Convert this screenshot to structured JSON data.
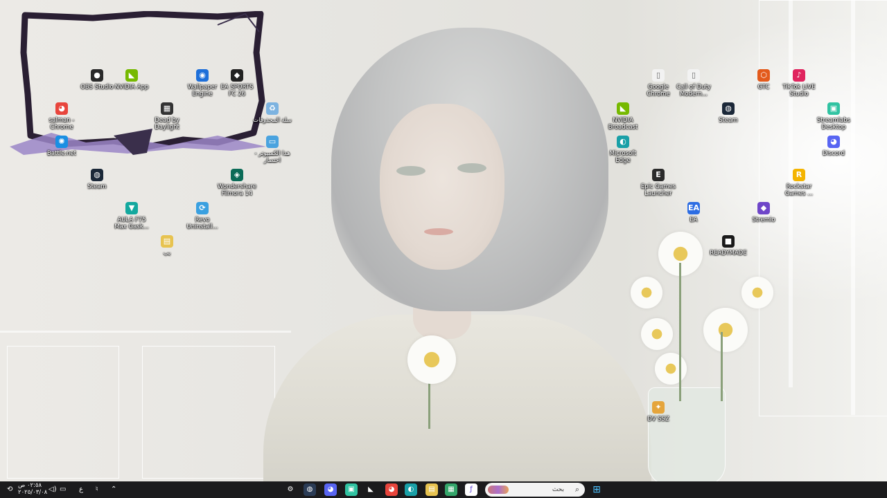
{
  "desktop": {
    "icons": [
      {
        "key": "obs",
        "label": "OBS Studio",
        "color": "#2a2a2a",
        "glyph": "●",
        "icon": "obs-icon"
      },
      {
        "key": "nvapp",
        "label": "NVIDIA App",
        "color": "#76b900",
        "glyph": "◣",
        "icon": "nvidia-icon"
      },
      {
        "key": "wallpaper",
        "label": "Wallpaper Engine",
        "color": "#1e6fd9",
        "glyph": "◉",
        "icon": "wallpaper-engine-icon"
      },
      {
        "key": "eafc",
        "label": "EA SPORTS FC 26",
        "color": "#222222",
        "glyph": "◆",
        "icon": "ea-fc-icon"
      },
      {
        "key": "chrome_user",
        "label": "salman - Chrome",
        "color": "#e8453c",
        "glyph": "◕",
        "icon": "chrome-icon"
      },
      {
        "key": "dbd",
        "label": "Dead by Daylight",
        "color": "#333333",
        "glyph": "▦",
        "icon": "dead-by-daylight-icon"
      },
      {
        "key": "recycle",
        "label": "سلة المحذوفات",
        "color": "#7db3e0",
        "glyph": "♻",
        "icon": "recycle-bin-icon"
      },
      {
        "key": "battlenet",
        "label": "Battle.net",
        "color": "#1a8fe3",
        "glyph": "✺",
        "icon": "battlenet-icon"
      },
      {
        "key": "pc",
        "label": "هذا الكمبيوتر - اختصار",
        "color": "#4aa3df",
        "glyph": "▭",
        "icon": "this-pc-icon"
      },
      {
        "key": "steam1",
        "label": "Steam",
        "color": "#1b2838",
        "glyph": "◍",
        "icon": "steam-icon"
      },
      {
        "key": "filmora",
        "label": "Wondershare Filmora 14",
        "color": "#0b6b57",
        "glyph": "◈",
        "icon": "filmora-icon"
      },
      {
        "key": "aura",
        "label": "AULA F75 Max Gask...",
        "color": "#13a89e",
        "glyph": "▼",
        "icon": "aula-keyboard-icon"
      },
      {
        "key": "revo",
        "label": "Revo Uninstall...",
        "color": "#3aa0e0",
        "glyph": "⟳",
        "icon": "revo-uninstaller-icon"
      },
      {
        "key": "folder",
        "label": "بب",
        "color": "#e7c350",
        "glyph": "▤",
        "icon": "folder-icon"
      },
      {
        "key": "gchrome",
        "label": "Google Chrome",
        "color": "#f2f2f2",
        "glyph": "▯",
        "icon": "file-shortcut-icon"
      },
      {
        "key": "cod",
        "label": "Call of Duty Modern...",
        "color": "#f2f2f2",
        "glyph": "▯",
        "icon": "file-shortcut-icon"
      },
      {
        "key": "gtc",
        "label": "GTC",
        "color": "#e35a1b",
        "glyph": "⬡",
        "icon": "gtc-icon"
      },
      {
        "key": "tiktok",
        "label": "TikTok LIVE Studio",
        "color": "#e0245e",
        "glyph": "♪",
        "icon": "tiktok-live-icon"
      },
      {
        "key": "nvbroadcast",
        "label": "NVIDIA Broadcast",
        "color": "#76b900",
        "glyph": "◣",
        "icon": "nvidia-broadcast-icon"
      },
      {
        "key": "steam2",
        "label": "Steam",
        "color": "#1b2838",
        "glyph": "◍",
        "icon": "steam-icon"
      },
      {
        "key": "streamlabs",
        "label": "Streamlabs Desktop",
        "color": "#31c3a2",
        "glyph": "▣",
        "icon": "streamlabs-icon"
      },
      {
        "key": "edge",
        "label": "Microsoft Edge",
        "color": "#1aa0a7",
        "glyph": "◐",
        "icon": "edge-icon"
      },
      {
        "key": "discord",
        "label": "Discord",
        "color": "#5865f2",
        "glyph": "◕",
        "icon": "discord-icon"
      },
      {
        "key": "epic",
        "label": "Epic Games Launcher",
        "color": "#2b2b2b",
        "glyph": "E",
        "icon": "epic-games-icon"
      },
      {
        "key": "rockstar",
        "label": "Rockstar Games ...",
        "color": "#f4b400",
        "glyph": "R",
        "icon": "rockstar-icon"
      },
      {
        "key": "ea",
        "label": "EA",
        "color": "#2d6de3",
        "glyph": "EA",
        "icon": "ea-app-icon"
      },
      {
        "key": "stremio",
        "label": "Stremio",
        "color": "#6f46c9",
        "glyph": "◆",
        "icon": "stremio-icon"
      },
      {
        "key": "readymade",
        "label": "READYMADE",
        "color": "#1a1a1a",
        "glyph": "■",
        "icon": "readymade-icon"
      },
      {
        "key": "dvssz",
        "label": "DV SSZ",
        "color": "#e5a53c",
        "glyph": "✦",
        "icon": "dv-ssz-icon"
      }
    ]
  },
  "taskbar": {
    "search_placeholder": "بحث",
    "clock_time": "٠٢:٥٨ ص",
    "clock_date": "٢٠٢٥/٠٣/٠٨",
    "language": "ع",
    "pinned": [
      {
        "name": "steam",
        "glyph": "◍",
        "color": "#2a3b55",
        "icon": "steam-icon"
      },
      {
        "name": "discord",
        "glyph": "◕",
        "color": "#5865f2",
        "icon": "discord-icon"
      },
      {
        "name": "streamlabs",
        "glyph": "▣",
        "color": "#31c3a2",
        "icon": "streamlabs-icon"
      },
      {
        "name": "nvidia",
        "glyph": "◣",
        "color": "#1b1b1d",
        "icon": "nvidia-icon"
      },
      {
        "name": "chrome",
        "glyph": "◕",
        "color": "#e8453c",
        "icon": "chrome-icon"
      },
      {
        "name": "edge",
        "glyph": "◐",
        "color": "#1aa0a7",
        "icon": "edge-icon"
      },
      {
        "name": "file-explorer",
        "glyph": "▤",
        "color": "#e7c350",
        "icon": "folder-icon"
      },
      {
        "name": "store",
        "glyph": "▦",
        "color": "#35a66b",
        "icon": "store-icon"
      },
      {
        "name": "app",
        "glyph": "ƒ",
        "color": "#ffffff",
        "icon": "app-icon"
      },
      {
        "name": "task-view",
        "glyph": "▭",
        "color": "#1b1b1d",
        "icon": "task-view-icon"
      }
    ]
  }
}
